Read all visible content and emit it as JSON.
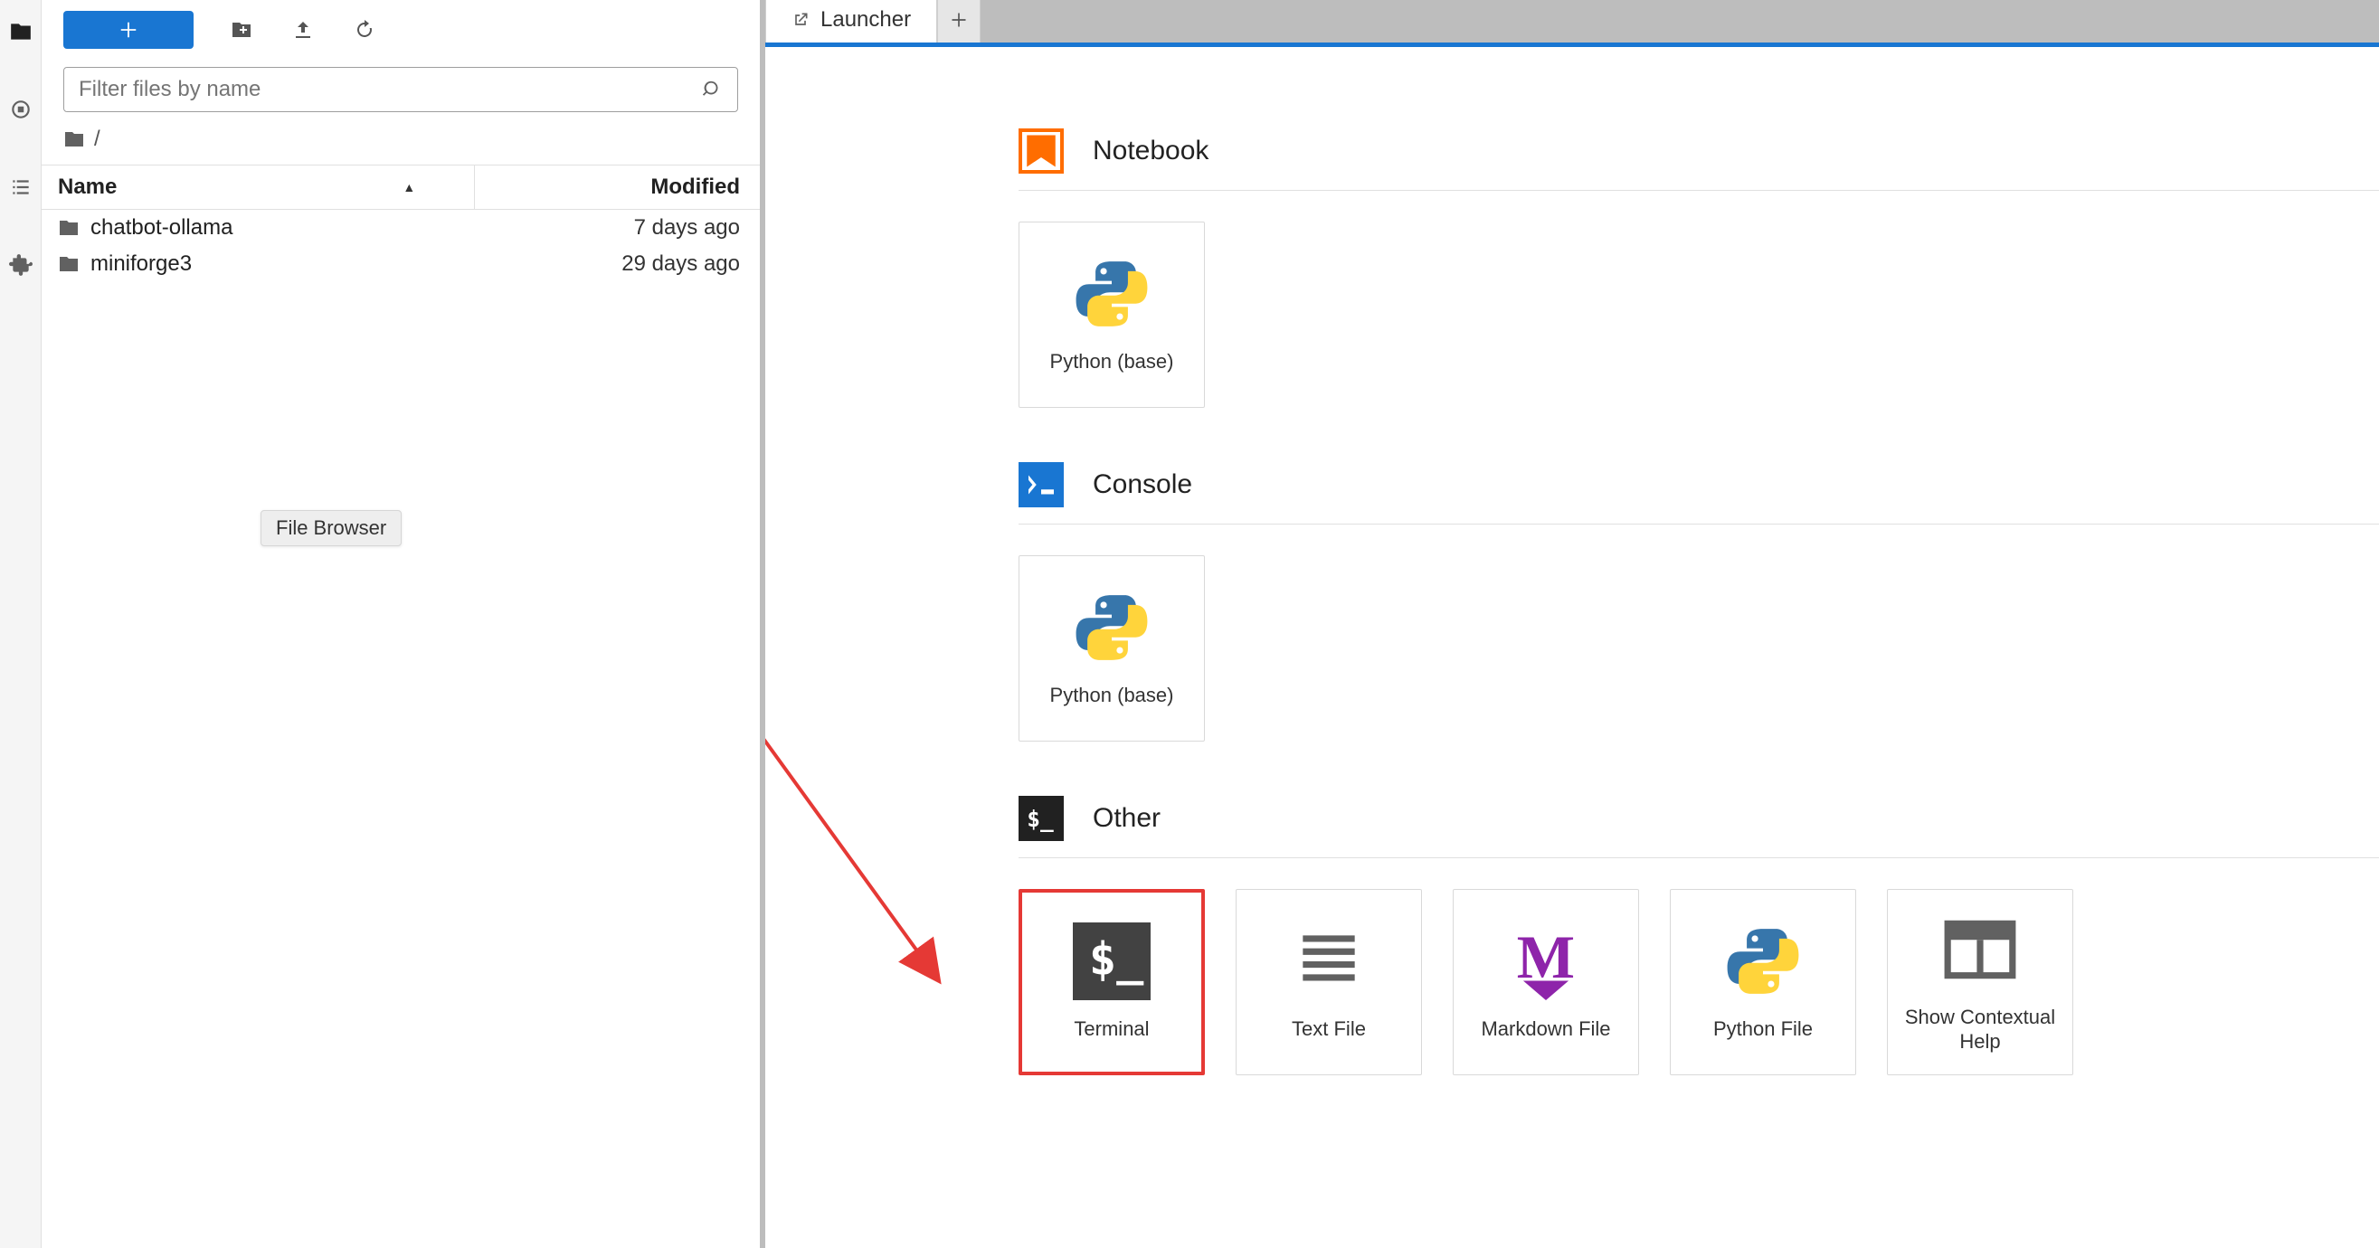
{
  "sidebar_tooltip": "File Browser",
  "file_panel": {
    "filter_placeholder": "Filter files by name",
    "breadcrumb": "/",
    "columns": {
      "name": "Name",
      "modified": "Modified"
    },
    "rows": [
      {
        "name": "chatbot-ollama",
        "modified": "7 days ago"
      },
      {
        "name": "miniforge3",
        "modified": "29 days ago"
      }
    ]
  },
  "tabs": {
    "active": "Launcher"
  },
  "launcher": {
    "sections": [
      {
        "title": "Notebook",
        "cards": [
          {
            "label": "Python (base)",
            "icon": "python"
          }
        ]
      },
      {
        "title": "Console",
        "cards": [
          {
            "label": "Python (base)",
            "icon": "python"
          }
        ]
      },
      {
        "title": "Other",
        "cards": [
          {
            "label": "Terminal",
            "icon": "terminal",
            "highlight": true
          },
          {
            "label": "Text File",
            "icon": "textfile"
          },
          {
            "label": "Markdown File",
            "icon": "markdown"
          },
          {
            "label": "Python File",
            "icon": "python"
          },
          {
            "label": "Show Contextual Help",
            "icon": "help"
          }
        ]
      }
    ]
  }
}
